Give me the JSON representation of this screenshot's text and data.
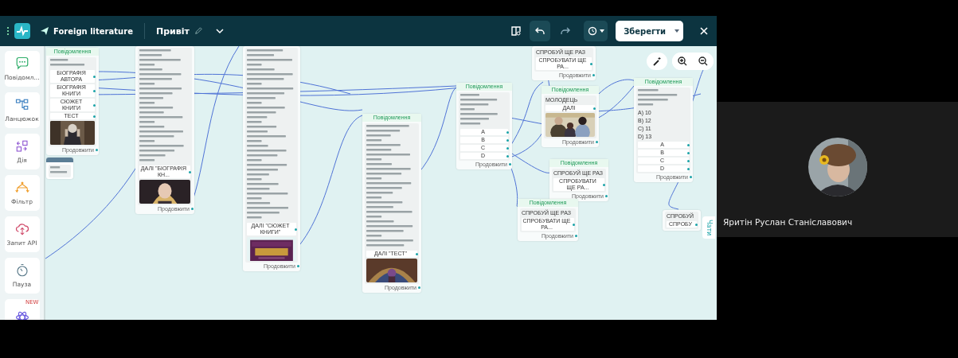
{
  "screen_share": {
    "top_bar": {
      "bot_name": "Foreign literature",
      "flow_name": "Привіт",
      "save_button": "Зберегти"
    },
    "sidebar": {
      "items": [
        {
          "label": "Повідомл..."
        },
        {
          "label": "Ланцюжок"
        },
        {
          "label": "Дія"
        },
        {
          "label": "Фільтр"
        },
        {
          "label": "Запит API"
        },
        {
          "label": "Пауза"
        },
        {
          "badge": "NEW"
        }
      ]
    },
    "canvas": {
      "nodes": [
        {
          "kind": "message",
          "header": "Повідомлення",
          "blocks": [
            {
              "kind": "blurred_text"
            },
            {
              "kind": "button",
              "label": "БІОГРАФІЯ АВТОРА"
            },
            {
              "kind": "button",
              "label": "БІОГРАФІЯ КНИГИ"
            },
            {
              "kind": "button",
              "label": "СЮЖЕТ КНИГИ"
            },
            {
              "kind": "button",
              "label": "ТЕСТ"
            },
            {
              "kind": "picture"
            }
          ],
          "footer": "Продовжити"
        },
        {
          "kind": "pause",
          "blocks": [
            {
              "kind": "blurred_text"
            }
          ]
        },
        {
          "kind": "message",
          "blocks": [
            {
              "kind": "blurred_text"
            },
            {
              "kind": "button",
              "label": "ДАЛІ \"БІОГРАФІЯ КН..."
            },
            {
              "kind": "picture"
            }
          ],
          "footer": "Продовжити"
        },
        {
          "kind": "message",
          "blocks": [
            {
              "kind": "blurred_text"
            },
            {
              "kind": "button",
              "label": "ДАЛІ \"СЮЖЕТ КНИГИ\""
            },
            {
              "kind": "picture"
            }
          ],
          "footer": "Продовжити"
        },
        {
          "kind": "message",
          "header": "Повідомлення",
          "blocks": [
            {
              "kind": "blurred_text"
            },
            {
              "kind": "button",
              "label": "ДАЛІ \"ТЕСТ\""
            },
            {
              "kind": "picture"
            }
          ],
          "footer": "Продовжити"
        },
        {
          "kind": "message",
          "header": "Повідомлення",
          "blocks": [
            {
              "kind": "blurred_text"
            },
            {
              "kind": "button",
              "label": "A"
            },
            {
              "kind": "button",
              "label": "B"
            },
            {
              "kind": "button",
              "label": "C"
            },
            {
              "kind": "button",
              "label": "D"
            }
          ],
          "footer": "Продовжити"
        },
        {
          "kind": "message",
          "blocks": [
            {
              "kind": "text",
              "text": "СПРОБУЙ ЩЕ РАЗ"
            },
            {
              "kind": "button",
              "label": "СПРОБУВАТИ ЩЕ РА..."
            }
          ],
          "footer": "Продовжити"
        },
        {
          "kind": "message",
          "header": "Повідомлення",
          "blocks": [
            {
              "kind": "text",
              "text": "МОЛОДЕЦЬ"
            },
            {
              "kind": "button",
              "label": "ДАЛІ"
            },
            {
              "kind": "picture"
            }
          ],
          "footer": "Продовжити"
        },
        {
          "kind": "message",
          "header": "Повідомлення",
          "blocks": [
            {
              "kind": "text",
              "text": "СПРОБУЙ ЩЕ РАЗ"
            },
            {
              "kind": "button",
              "label": "СПРОБУВАТИ ЩЕ РА..."
            }
          ],
          "footer": "Продовжити"
        },
        {
          "kind": "message",
          "header": "Повідомлення",
          "blocks": [
            {
              "kind": "text",
              "text": "СПРОБУЙ ЩЕ РАЗ"
            },
            {
              "kind": "button",
              "label": "СПРОБУВАТИ ЩЕ РА..."
            }
          ],
          "footer": "Продовжити"
        },
        {
          "kind": "message",
          "header": "Повідомлення",
          "blocks": [
            {
              "kind": "blurred_text"
            },
            {
              "kind": "text",
              "text": "A) 10"
            },
            {
              "kind": "text",
              "text": "B) 12"
            },
            {
              "kind": "text",
              "text": "C) 11"
            },
            {
              "kind": "text",
              "text": "D) 13"
            },
            {
              "kind": "button",
              "label": "A"
            },
            {
              "kind": "button",
              "label": "B"
            },
            {
              "kind": "button",
              "label": "C"
            },
            {
              "kind": "button",
              "label": "D"
            }
          ],
          "footer": "Продовжити"
        },
        {
          "kind": "message",
          "blocks": [
            {
              "kind": "text",
              "text": "СПРОБУЙ"
            },
            {
              "kind": "button",
              "label": "СПРОБУ"
            }
          ]
        }
      ],
      "chats_tab": "Чати"
    }
  },
  "participant": {
    "name": "Яритін Руслан Станіславович"
  }
}
